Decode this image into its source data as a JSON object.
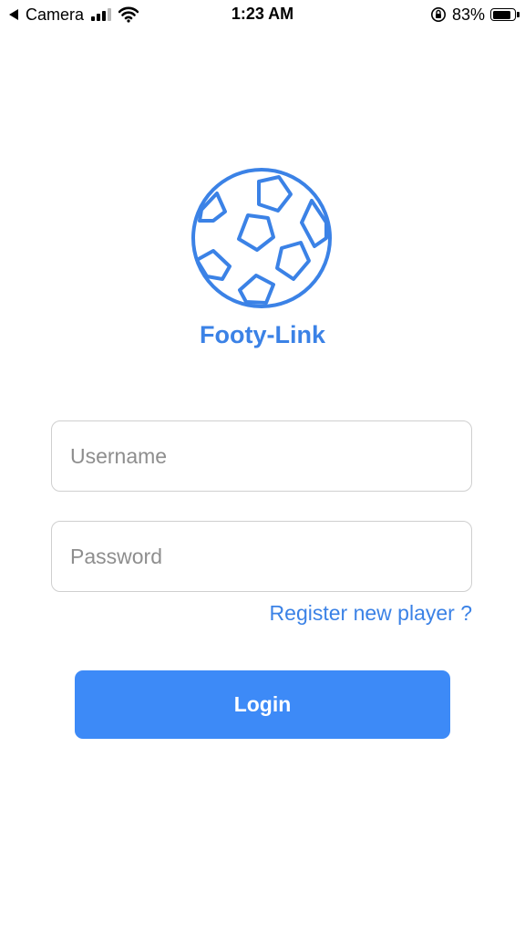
{
  "status_bar": {
    "back_app": "Camera",
    "time": "1:23 AM",
    "battery_percent": "83%",
    "battery_level": 0.83
  },
  "app": {
    "name": "Footy-Link",
    "logo_icon": "soccer-ball-icon",
    "accent_color": "#3b82e6"
  },
  "form": {
    "username": {
      "value": "",
      "placeholder": "Username"
    },
    "password": {
      "value": "",
      "placeholder": "Password"
    },
    "register_link": "Register new player ?",
    "login_label": "Login",
    "button_color": "#3d8af7"
  }
}
